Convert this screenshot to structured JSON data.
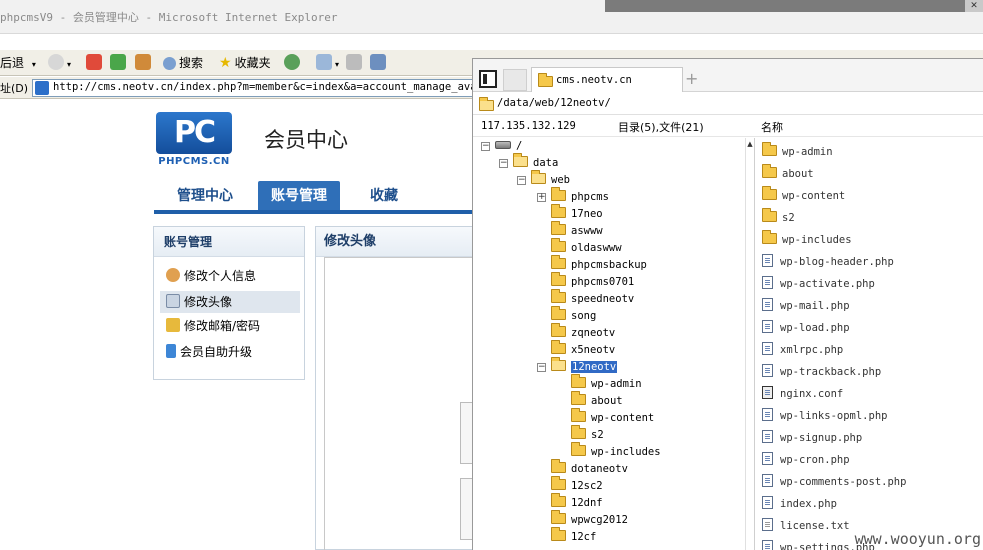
{
  "window": {
    "title": "phpcmsV9 - 会员管理中心 - Microsoft Internet Explorer"
  },
  "toolbar": {
    "back": "后退",
    "search": "搜索",
    "favorites": "收藏夹"
  },
  "address": {
    "label": "址(D)",
    "url": "http://cms.neotv.cn/index.php?m=member&c=index&a=account_manage_avatar"
  },
  "page": {
    "logo_mark": "PC",
    "logo_text": "PHPCMS.CN",
    "header_title": "会员中心",
    "nav": [
      "管理中心",
      "账号管理",
      "收藏"
    ],
    "sidebar_title": "账号管理",
    "sidebar_items": [
      "修改个人信息",
      "修改头像",
      "修改邮箱/密码",
      "会员自助升级"
    ],
    "content_title": "修改头像"
  },
  "file_manager": {
    "tab_label": "cms.neotv.cn",
    "plus": "+",
    "path": "/data/web/12neotv/",
    "server_ip": "117.135.132.129",
    "summary": "目录(5),文件(21)",
    "name_column": "名称",
    "tree": {
      "root": "/",
      "data": "data",
      "web": "web",
      "web_children": [
        "phpcms",
        "17neo",
        "aswww",
        "oldaswww",
        "phpcmsbackup",
        "phpcms0701",
        "speedneotv",
        "song",
        "zqneotv",
        "x5neotv"
      ],
      "selected": "12neotv",
      "selected_children": [
        "wp-admin",
        "about",
        "wp-content",
        "s2",
        "wp-includes"
      ],
      "after": [
        "dotaneotv",
        "12sc2",
        "12dnf",
        "wpwcg2012",
        "12cf"
      ]
    },
    "folders": [
      "wp-admin",
      "about",
      "wp-content",
      "s2",
      "wp-includes"
    ],
    "files": [
      "wp-blog-header.php",
      "wp-activate.php",
      "wp-mail.php",
      "wp-load.php",
      "xmlrpc.php",
      "wp-trackback.php",
      "nginx.conf",
      "wp-links-opml.php",
      "wp-signup.php",
      "wp-cron.php",
      "wp-comments-post.php",
      "index.php",
      "license.txt",
      "wp-settings.php"
    ]
  },
  "watermark": "www.wooyun.org",
  "colors": {
    "accent": "#2f6fb8",
    "selection": "#316ac5",
    "folder": "#f5c84a"
  }
}
